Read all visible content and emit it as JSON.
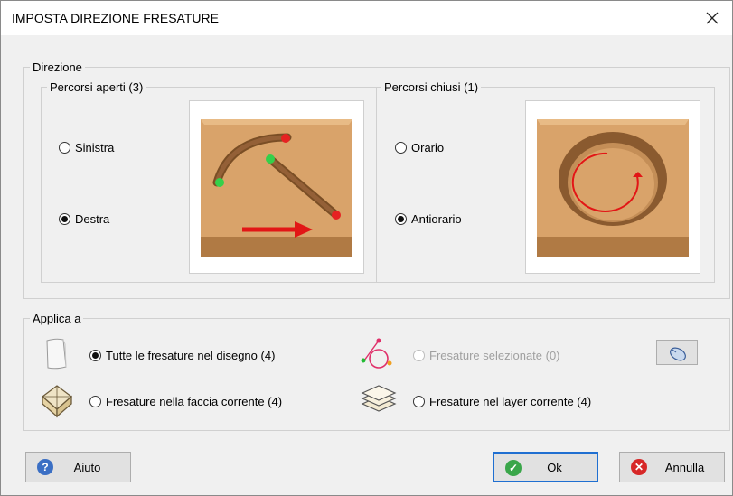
{
  "window": {
    "title": "IMPOSTA DIREZIONE FRESATURE",
    "close_icon": "close-icon"
  },
  "direction": {
    "group_label": "Direzione",
    "open_paths": {
      "label": "Percorsi aperti (3)",
      "options": [
        {
          "label": "Sinistra",
          "selected": false
        },
        {
          "label": "Destra",
          "selected": true
        }
      ]
    },
    "closed_paths": {
      "label": "Percorsi chiusi (1)",
      "options": [
        {
          "label": "Orario",
          "selected": false
        },
        {
          "label": "Antiorario",
          "selected": true
        }
      ]
    }
  },
  "apply": {
    "group_label": "Applica a",
    "options": [
      {
        "label": "Tutte le fresature nel disegno (4)",
        "selected": true,
        "enabled": true,
        "icon": "sheet-icon"
      },
      {
        "label": "Fresature selezionate (0)",
        "selected": false,
        "enabled": false,
        "icon": "selected-path-icon"
      },
      {
        "label": "Fresature nella faccia corrente (4)",
        "selected": false,
        "enabled": true,
        "icon": "face-cube-icon"
      },
      {
        "label": "Fresature nel layer corrente (4)",
        "selected": false,
        "enabled": true,
        "icon": "layers-icon"
      }
    ],
    "select_button_icon": "mouse-icon"
  },
  "buttons": {
    "help": "Aiuto",
    "ok": "Ok",
    "cancel": "Annulla"
  }
}
